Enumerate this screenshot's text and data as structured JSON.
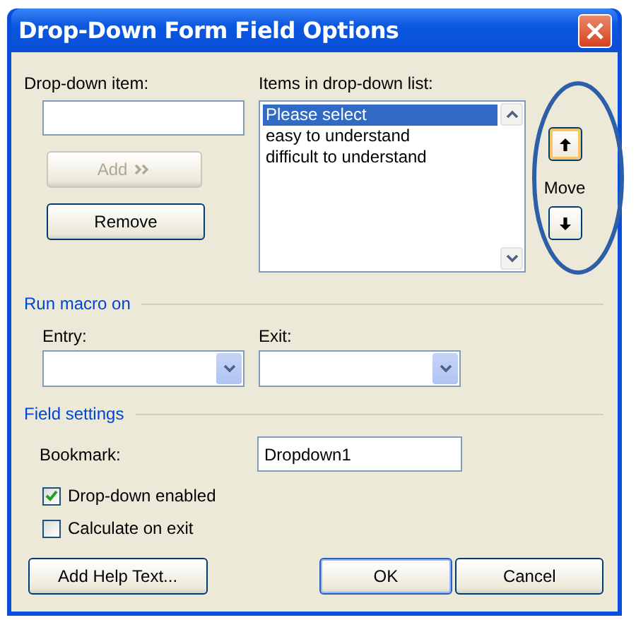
{
  "window": {
    "title": "Drop-Down Form Field Options"
  },
  "item_field": {
    "label": "Drop-down item:"
  },
  "item_buttons": [
    {
      "label": "Add",
      "kind": "add",
      "disabled": true
    },
    {
      "label": "Remove",
      "kind": "plain",
      "disabled": false
    }
  ],
  "list": {
    "label": "Items in drop-down list:",
    "items": [
      {
        "text": "Please select",
        "selected": true
      },
      {
        "text": "easy to understand",
        "selected": false
      },
      {
        "text": "difficult to understand",
        "selected": false
      }
    ]
  },
  "move": {
    "label": "Move"
  },
  "run_macro": {
    "title": "Run macro on",
    "entry": {
      "label": "Entry:"
    },
    "exit": {
      "label": "Exit:"
    }
  },
  "field_settings": {
    "title": "Field settings",
    "bookmark": {
      "label": "Bookmark:",
      "value": "Dropdown1"
    },
    "checkboxes": [
      {
        "label": "Drop-down enabled",
        "checked": true
      },
      {
        "label": "Calculate on exit",
        "checked": false
      }
    ]
  },
  "buttons": [
    {
      "label": "Add Help Text...",
      "default": false
    },
    {
      "label": "OK",
      "default": true
    },
    {
      "label": "Cancel",
      "default": false
    }
  ]
}
